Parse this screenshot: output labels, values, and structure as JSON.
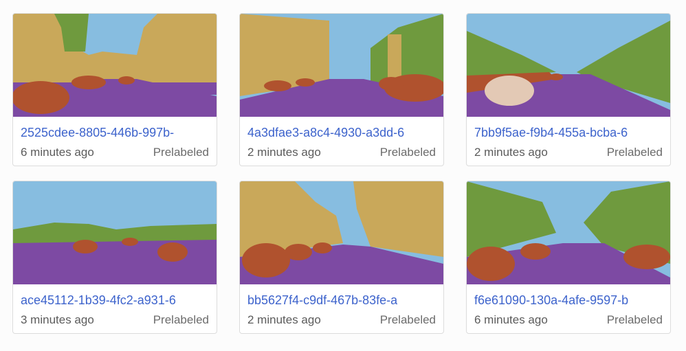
{
  "items": [
    {
      "name": "2525cdee-8805-446b-997b-",
      "time": "6 minutes ago",
      "status": "Prelabeled"
    },
    {
      "name": "4a3dfae3-a8c4-4930-a3dd-6",
      "time": "2 minutes ago",
      "status": "Prelabeled"
    },
    {
      "name": "7bb9f5ae-f9b4-455a-bcba-6",
      "time": "2 minutes ago",
      "status": "Prelabeled"
    },
    {
      "name": "ace45112-1b39-4fc2-a931-6",
      "time": "3 minutes ago",
      "status": "Prelabeled"
    },
    {
      "name": "bb5627f4-c9df-467b-83fe-a",
      "time": "2 minutes ago",
      "status": "Prelabeled"
    },
    {
      "name": "f6e61090-130a-4afe-9597-b",
      "time": "6 minutes ago",
      "status": "Prelabeled"
    }
  ],
  "colors": {
    "sky": "#87bde0",
    "building": "#c9a85a",
    "vegetation": "#6f9a3e",
    "road": "#7d4aa3",
    "car": "#b0522e",
    "link": "#3d63cc"
  }
}
